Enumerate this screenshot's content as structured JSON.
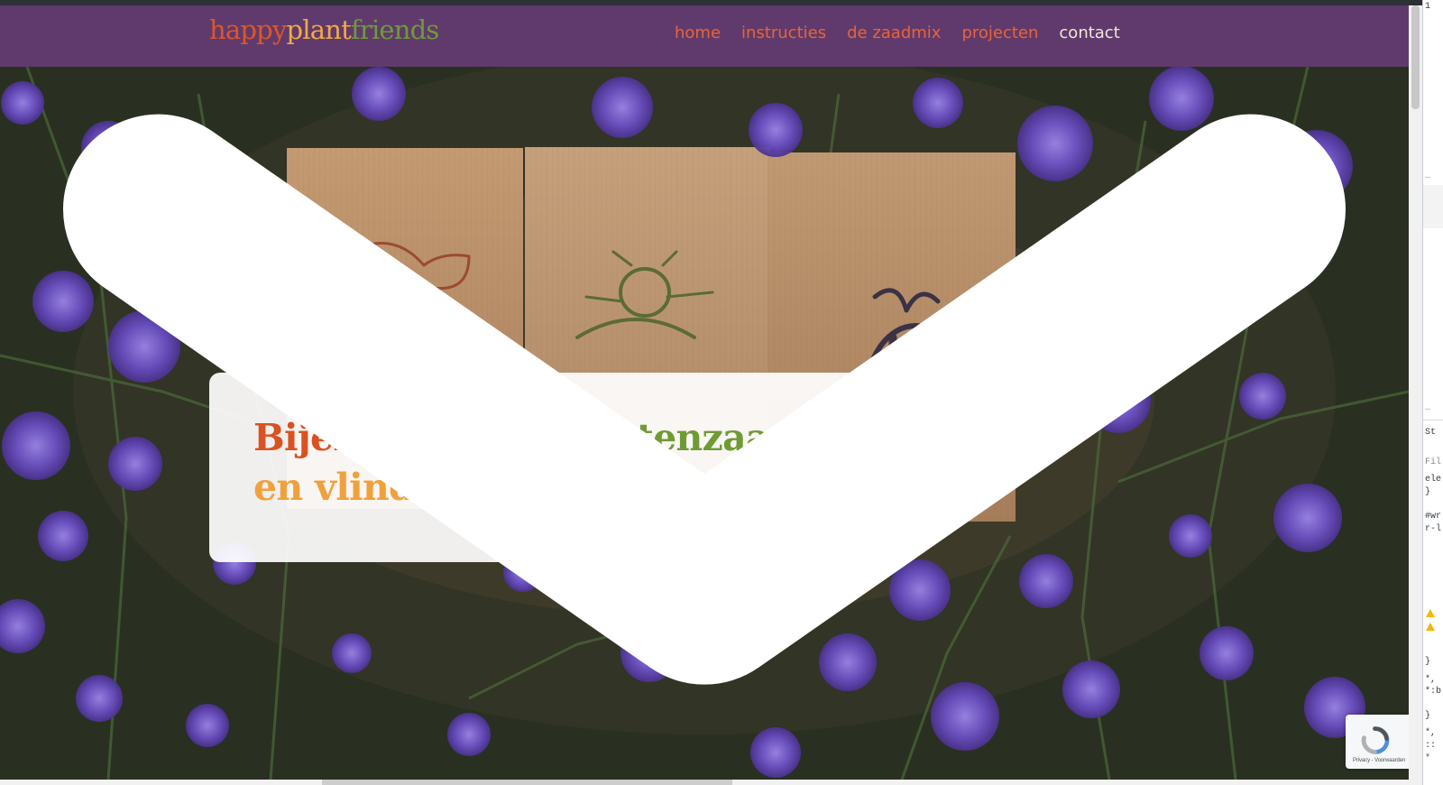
{
  "site": {
    "logo": {
      "part1": "happy",
      "part2": "plant",
      "part3": "friends",
      "colors": {
        "part1": "#de5626",
        "part2": "#f1aa45",
        "part3": "#6e9b35"
      }
    },
    "nav": {
      "items": [
        {
          "label": "home",
          "active": false
        },
        {
          "label": "instructies",
          "active": false
        },
        {
          "label": "de zaadmix",
          "active": false
        },
        {
          "label": "projecten",
          "active": false
        },
        {
          "label": "contact",
          "active": true
        }
      ]
    },
    "hero": {
      "title_line1_part1": "Bijenzaadjes",
      "title_line1_comma": ",",
      "title_line1_part2": "insectenzaadjes",
      "title_line2": "en vlinderzaadjes",
      "title_colors": {
        "part1": "#d95222",
        "part2": "#6f9b35",
        "line2": "#f0a13d"
      },
      "scroll_icon": "chevron-down-icon"
    },
    "recaptcha": {
      "text": "Privacy - Voorwaarden"
    },
    "header_bg": "#603a6d"
  },
  "devtools": {
    "lines": {
      "l1": "1",
      "l2": "…",
      "l3": "…",
      "l4": "St",
      "l5": "Fil",
      "l6": "ele",
      "l7": "}",
      "l8": "#wr",
      "l9": "r-l",
      "l10": "}",
      "l11": "*,",
      "l12": "*:b",
      "l13": "}",
      "l14": "*,",
      "l15": "::",
      "l16": "▾"
    }
  }
}
